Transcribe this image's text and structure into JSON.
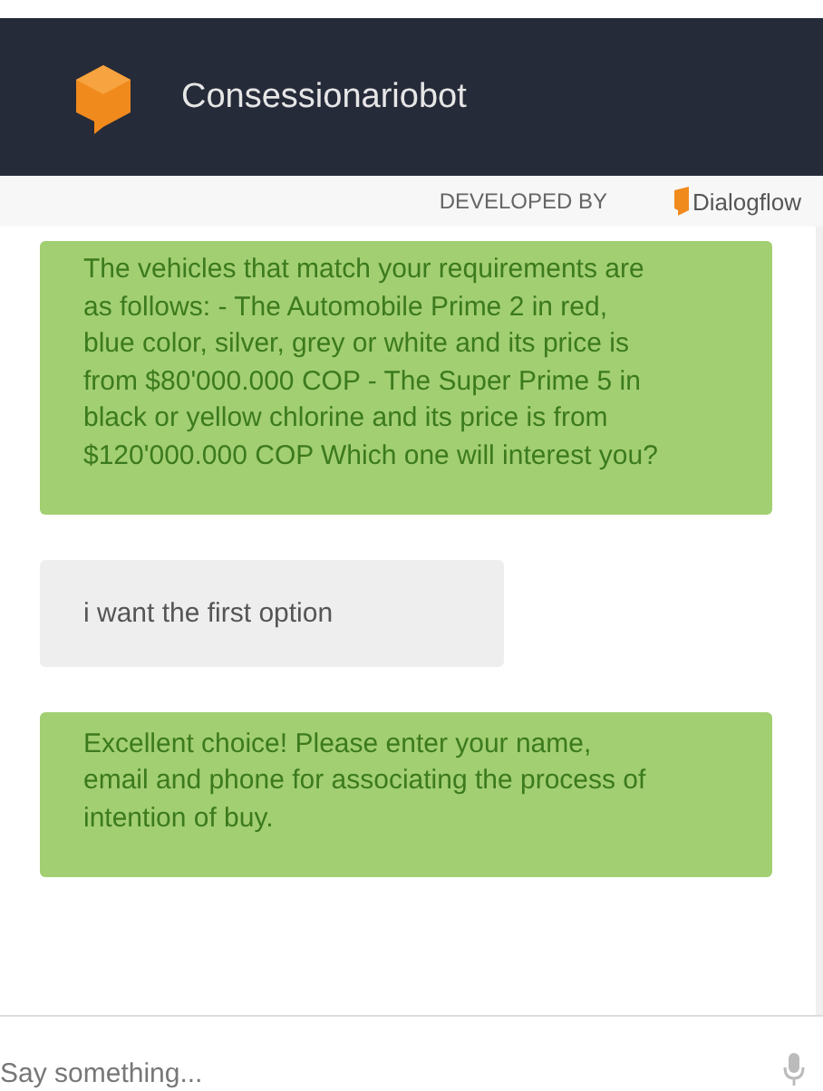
{
  "header": {
    "title": "Consessionariobot"
  },
  "credit": {
    "label": "DEVELOPED BY",
    "brand": "Dialogflow"
  },
  "messages": [
    {
      "kind": "bot",
      "text": "The vehicles that match your requirements are as follows: - The Automobile Prime 2 in red, blue color, silver, grey or white and its price is from $80'000.000 COP - The Super Prime 5 in black or yellow chlorine and its price is from $120'000.000 COP Which one will interest you?"
    },
    {
      "kind": "user",
      "text": "i want the first option"
    },
    {
      "kind": "bot",
      "text": "Excellent choice! Please enter your name, email and phone for associating the process of intention of buy."
    }
  ],
  "input": {
    "placeholder": "Say something..."
  }
}
